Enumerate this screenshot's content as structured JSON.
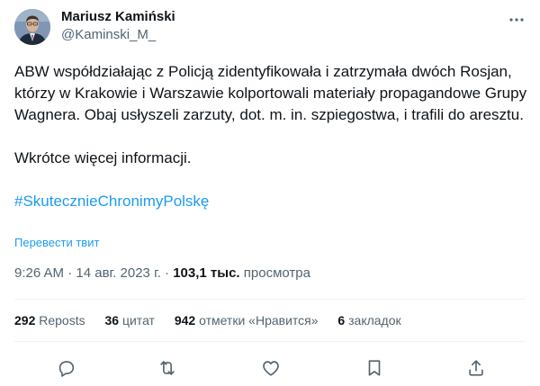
{
  "author": {
    "name": "Mariusz Kamiński",
    "handle": "@Kaminski_M_"
  },
  "tweet": {
    "paragraph1": "ABW współdziałając z Policją zidentyfikowała i zatrzymała dwóch Rosjan, którzy w Krakowie i Warszawie kolportowali materiały propagandowe Grupy Wagnera. Obaj usłyszeli zarzuty, dot. m. in. szpiegostwa, i trafili do aresztu.",
    "paragraph2": "Wkrótce więcej informacji.",
    "hashtag": "#SkutecznieChronimyPolskę",
    "translate_label": "Перевести твит"
  },
  "meta": {
    "time": "9:26 AM",
    "sep": " · ",
    "date": "14 авг. 2023 г.",
    "views_count": "103,1 тыс.",
    "views_label": "просмотра"
  },
  "stats": {
    "reposts_count": "292",
    "reposts_label": "Reposts",
    "quotes_count": "36",
    "quotes_label": "цитат",
    "likes_count": "942",
    "likes_label": "отметки «Нравится»",
    "bookmarks_count": "6",
    "bookmarks_label": "закладок"
  },
  "icons": {
    "more": "more-dots-icon",
    "reply": "reply-icon",
    "repost": "repost-icon",
    "like": "heart-icon",
    "bookmark": "bookmark-icon",
    "share": "share-icon"
  },
  "colors": {
    "text": "#0f1419",
    "secondary": "#536471",
    "link": "#1d9bf0",
    "divider": "#eff3f4"
  }
}
